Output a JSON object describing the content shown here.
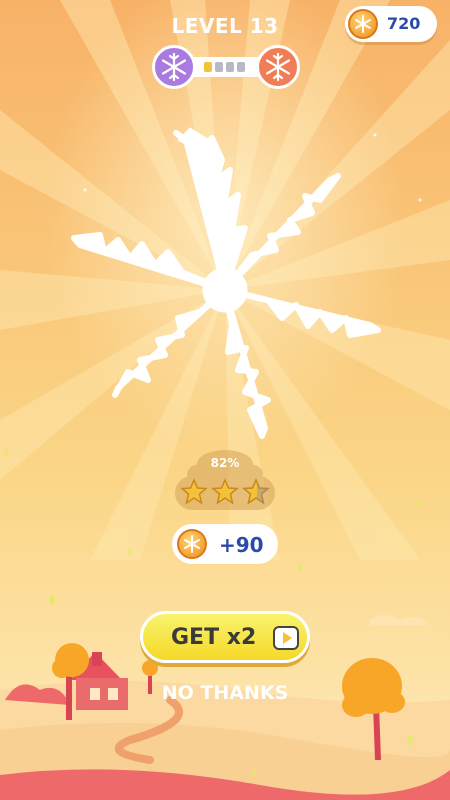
{
  "header": {
    "level_label": "LEVEL 13",
    "coins": "720"
  },
  "level_progress": {
    "current_badge_icon": "snowflake-icon",
    "next_badge_icon": "snowflake-icon",
    "segments_total": 4,
    "segments_done": 1
  },
  "result": {
    "percent": "82%",
    "stars_total": 3,
    "stars_earned": 2.5
  },
  "reward": {
    "amount": "+90",
    "icon": "coin-icon"
  },
  "buttons": {
    "get_label": "GET x2",
    "get_icon": "play-icon",
    "no_thanks_label": "NO THANKS"
  },
  "colors": {
    "coin_text": "#2c4aa7",
    "button_yellow": "#f5d928",
    "badge_current": "#a97be0",
    "badge_next": "#f07d56",
    "star_gold": "#f4c239"
  }
}
